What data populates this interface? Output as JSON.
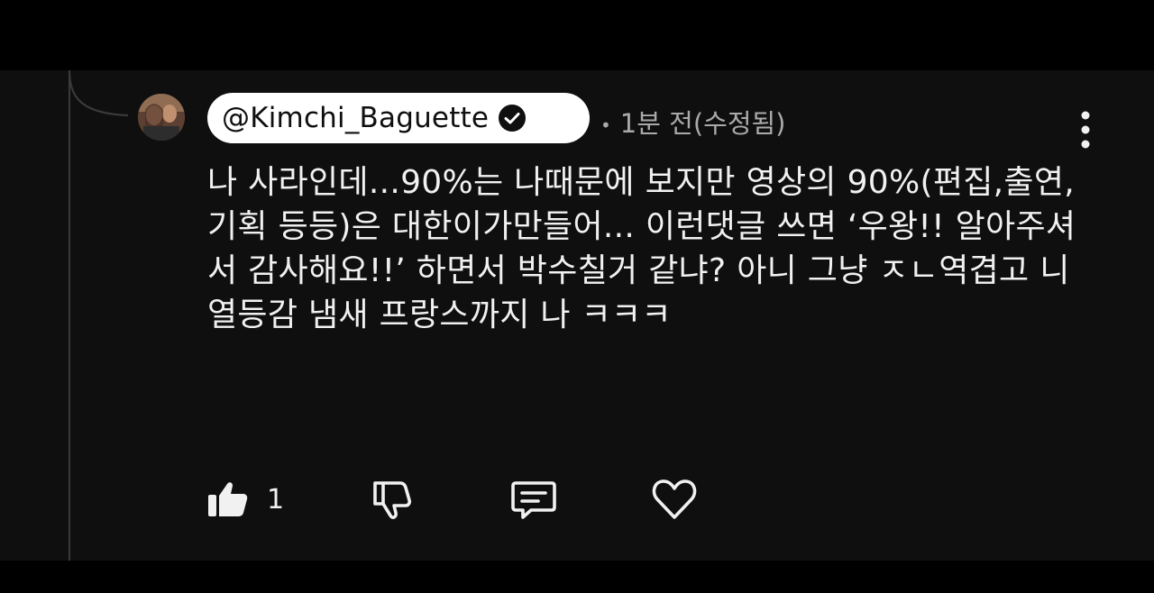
{
  "comment": {
    "author": "@Kimchi_Baguette",
    "verified": true,
    "time": "1분 전(수정됨)",
    "text": "나 사라인데...90%는 나때문에 보지만 영상의 90%(편집,출연,기획 등등)은 대한이가만들어... 이런댓글 쓰면 ‘우왕!! 알아주셔서 감사해요!!’ 하면서 박수칠거 같냐? 아니 그냥 ㅈㄴ역겹고 니 열등감 냄새 프랑스까지 나 ㅋㅋㅋ",
    "likes": "1"
  },
  "icons": {
    "avatar": "avatar",
    "verified": "verified-check-icon",
    "more": "more-vert-icon",
    "like": "thumbs-up-filled-icon",
    "dislike": "thumbs-down-outline-icon",
    "reply": "comment-reply-icon",
    "heart": "heart-outline-icon"
  },
  "colors": {
    "background": "#0f0f0f",
    "text": "#f1f1f1",
    "meta": "#aaaaaa",
    "pill": "#ffffff"
  }
}
